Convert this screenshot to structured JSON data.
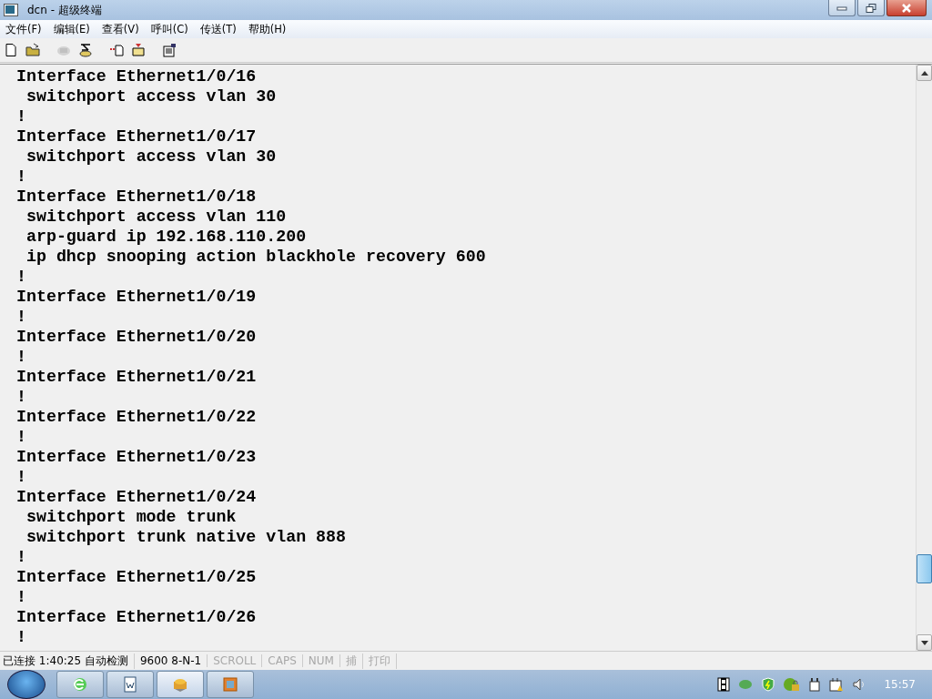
{
  "window": {
    "title": "dcn - 超级终端"
  },
  "menu": [
    "文件(F)",
    "编辑(E)",
    "查看(V)",
    "呼叫(C)",
    "传送(T)",
    "帮助(H)"
  ],
  "toolbar": [
    {
      "kind": "new",
      "disabled": false
    },
    {
      "kind": "open",
      "disabled": false
    },
    {
      "kind": "disconnect",
      "disabled": true
    },
    {
      "kind": "call",
      "disabled": false
    },
    {
      "kind": "send",
      "disabled": false
    },
    {
      "kind": "receive",
      "disabled": false
    },
    {
      "kind": "properties",
      "disabled": false
    }
  ],
  "terminal": {
    "lines": [
      "Interface Ethernet1/0/16",
      " switchport access vlan 30",
      "!",
      "Interface Ethernet1/0/17",
      " switchport access vlan 30",
      "!",
      "Interface Ethernet1/0/18",
      " switchport access vlan 110",
      " arp-guard ip 192.168.110.200",
      " ip dhcp snooping action blackhole recovery 600",
      "!",
      "Interface Ethernet1/0/19",
      "!",
      "Interface Ethernet1/0/20",
      "!",
      "Interface Ethernet1/0/21",
      "!",
      "Interface Ethernet1/0/22",
      "!",
      "Interface Ethernet1/0/23",
      "!",
      "Interface Ethernet1/0/24",
      " switchport mode trunk",
      " switchport trunk native vlan 888",
      "!",
      "Interface Ethernet1/0/25",
      "!",
      "Interface Ethernet1/0/26",
      "!"
    ]
  },
  "status_bar": [
    {
      "text": "已连接 1:40:25 自动检测",
      "active": true
    },
    {
      "text": "9600 8-N-1",
      "active": true
    },
    {
      "text": "SCROLL",
      "active": false
    },
    {
      "text": "CAPS",
      "active": false
    },
    {
      "text": "NUM",
      "active": false
    },
    {
      "text": "捕",
      "active": false
    },
    {
      "text": "打印",
      "active": false
    }
  ],
  "taskbar": {
    "apps": [
      {
        "kind": "browser",
        "selected": false
      },
      {
        "kind": "document",
        "selected": false
      },
      {
        "kind": "terminal",
        "selected": true
      },
      {
        "kind": "window",
        "selected": false
      }
    ],
    "clock": "15:57"
  }
}
